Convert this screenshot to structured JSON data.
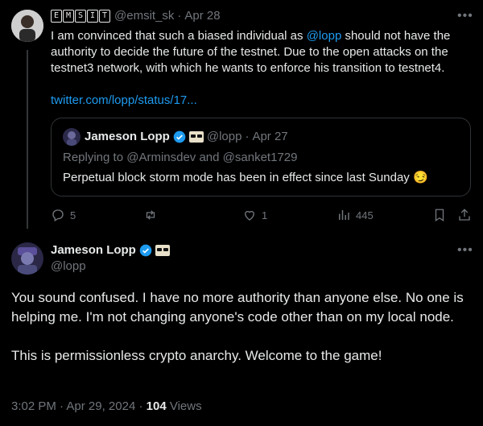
{
  "tweet1": {
    "author_handle": "@emsit_sk",
    "author_name_tiles": [
      "E",
      "M",
      "S",
      "I",
      "T"
    ],
    "date": "Apr 28",
    "text_before": "I am convinced that such a biased individual as ",
    "mention": "@lopp",
    "text_after": "  should not have the authority to decide the future of the testnet. Due to the open attacks on the testnet3 network, with which he wants to enforce his transition to testnet4.",
    "link": "twitter.com/lopp/status/17...",
    "quote": {
      "author_name": "Jameson Lopp",
      "author_handle": "@lopp",
      "date": "Apr 27",
      "replying_prefix": "Replying to ",
      "replying_users": "@Arminsdev and @sanket1729",
      "text": "Perpetual block storm mode has been in effect since last Sunday 😏"
    },
    "actions": {
      "replies": "5",
      "retweets": "",
      "likes": "1",
      "views": "445"
    }
  },
  "tweet2": {
    "author_name": "Jameson Lopp",
    "author_handle": "@lopp",
    "paragraph1": "You sound confused. I have no more authority than anyone else. No one is helping me. I'm not changing anyone's code other than on my local node.",
    "paragraph2": "This is permissionless crypto anarchy. Welcome to the game!",
    "time": "3:02 PM",
    "date": "Apr 29, 2024",
    "views_count": "104",
    "views_label": " Views"
  },
  "colors": {
    "background": "#000000",
    "text": "#e7e9ea",
    "muted": "#71767b",
    "link": "#1d9bf0",
    "verified": "#1d9bf0"
  },
  "icons": [
    "more-icon",
    "verified-badge-icon",
    "reply-icon",
    "retweet-icon",
    "like-icon",
    "views-icon",
    "bookmark-icon",
    "share-icon",
    "sunglasses-icon"
  ]
}
